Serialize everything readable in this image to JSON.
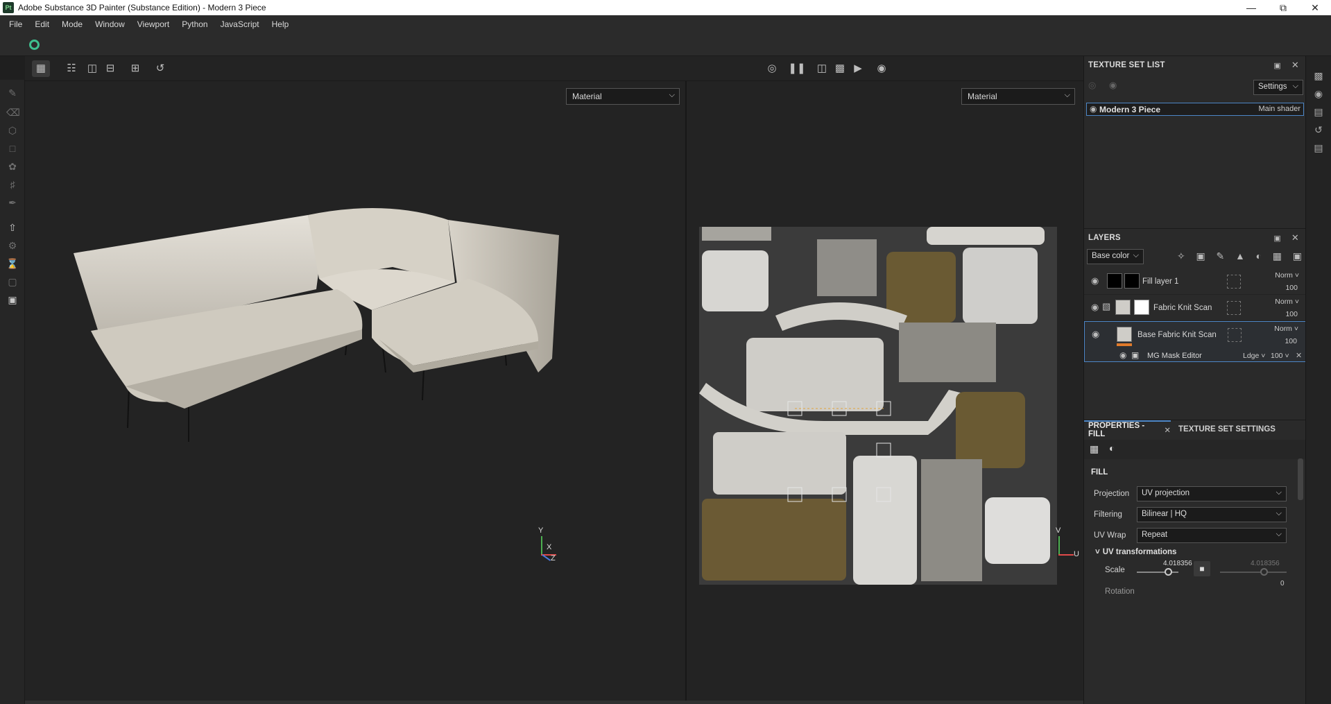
{
  "window": {
    "title": "Adobe Substance 3D Painter (Substance Edition) - Modern 3 Piece",
    "app_icon": "Pt"
  },
  "menu": [
    "File",
    "Edit",
    "Mode",
    "Window",
    "Viewport",
    "Python",
    "JavaScript",
    "Help"
  ],
  "viewport": {
    "left_material": "Material",
    "right_material": "Material",
    "axis_3d": {
      "y": "Y",
      "x": "X",
      "z": "Z"
    },
    "axis_2d": {
      "v": "V",
      "u": "U"
    }
  },
  "texture_set_list": {
    "title": "TEXTURE SET LIST",
    "settings_label": "Settings",
    "item_name": "Modern 3 Piece",
    "item_shader": "Main shader"
  },
  "layers": {
    "title": "LAYERS",
    "channel": "Base color",
    "items": [
      {
        "name": "Fill layer 1",
        "blend": "Norm",
        "opacity": "100"
      },
      {
        "name": "Fabric Knit Scan",
        "blend": "Norm",
        "opacity": "100"
      },
      {
        "name": "Base Fabric Knit Scan",
        "blend": "Norm",
        "opacity": "100"
      }
    ],
    "effect": {
      "name": "MG Mask Editor",
      "blend": "Ldge",
      "opacity": "100"
    }
  },
  "properties": {
    "tab_fill": "PROPERTIES - FILL",
    "tab_tss": "TEXTURE SET SETTINGS",
    "section": "FILL",
    "projection_label": "Projection",
    "projection_value": "UV projection",
    "filtering_label": "Filtering",
    "filtering_value": "Bilinear | HQ",
    "uvwrap_label": "UV Wrap",
    "uvwrap_value": "Repeat",
    "uvtransform_label": "UV transformations",
    "scale_label": "Scale",
    "scale_value": "4.018356",
    "scale_value2": "4.018356",
    "scale_fraction": 0.1,
    "rotation_label": "Rotation",
    "rotation_value": "0"
  },
  "colors": {
    "accent": "#4d87c7",
    "orange": "#e07a2a",
    "teal": "#3fbf8f"
  }
}
